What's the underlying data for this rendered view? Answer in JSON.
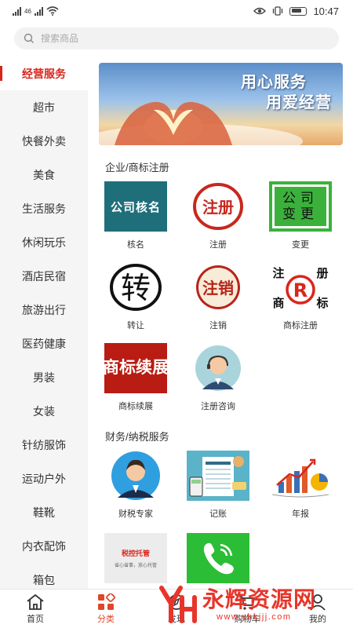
{
  "status_bar": {
    "signal_label": "46",
    "time": "10:47"
  },
  "search": {
    "placeholder": "搜索商品"
  },
  "sidebar": {
    "items": [
      {
        "label": "经营服务",
        "active": true
      },
      {
        "label": "超市"
      },
      {
        "label": "快餐外卖"
      },
      {
        "label": "美食"
      },
      {
        "label": "生活服务"
      },
      {
        "label": "休闲玩乐"
      },
      {
        "label": "酒店民宿"
      },
      {
        "label": "旅游出行"
      },
      {
        "label": "医药健康"
      },
      {
        "label": "男装"
      },
      {
        "label": "女装"
      },
      {
        "label": "针纺服饰"
      },
      {
        "label": "运动户外"
      },
      {
        "label": "鞋靴"
      },
      {
        "label": "内衣配饰"
      },
      {
        "label": "箱包"
      }
    ]
  },
  "banner": {
    "line1": "用心服务",
    "line2": "用爱经营"
  },
  "sections": [
    {
      "title": "企业/商标注册",
      "items": [
        {
          "label": "核名",
          "pic_text": "公司核名",
          "icon": "company-name-icon"
        },
        {
          "label": "注册",
          "pic_text": "注册",
          "icon": "register-stamp-icon"
        },
        {
          "label": "变更",
          "pic_text_1": "公司",
          "pic_text_2": "变更",
          "icon": "company-change-icon"
        },
        {
          "label": "转让",
          "pic_text": "转",
          "icon": "transfer-icon"
        },
        {
          "label": "注销",
          "pic_text": "注销",
          "icon": "cancel-stamp-icon"
        },
        {
          "label": "商标注册",
          "pic_text_1": "注",
          "pic_text_2": "册",
          "pic_text_3": "商",
          "pic_text_4": "标",
          "pic_text_r": "R",
          "icon": "trademark-icon"
        },
        {
          "label": "商标续展",
          "pic_text_1": "商",
          "pic_text_2": "标",
          "pic_text_3": "续",
          "pic_text_4": "展",
          "icon": "trademark-renewal-icon"
        },
        {
          "label": "注册咨询",
          "icon": "consultant-avatar-icon"
        }
      ]
    },
    {
      "title": "财务/纳税服务",
      "items": [
        {
          "label": "财税专家",
          "icon": "tax-expert-avatar-icon"
        },
        {
          "label": "记账",
          "icon": "bookkeeping-icon"
        },
        {
          "label": "年报",
          "icon": "annual-report-chart-icon"
        },
        {
          "label": "",
          "pic_text_1": "税控托管",
          "pic_text_2": "省心省事，放心托管",
          "icon": "tax-control-icon"
        },
        {
          "label": "",
          "icon": "phone-icon"
        }
      ]
    }
  ],
  "bottom_nav": {
    "items": [
      {
        "label": "首页",
        "icon": "home-icon"
      },
      {
        "label": "分类",
        "icon": "category-icon",
        "active": true
      },
      {
        "label": "发现",
        "icon": "discover-icon"
      },
      {
        "label": "购物车",
        "icon": "cart-icon"
      },
      {
        "label": "我的",
        "icon": "profile-icon"
      }
    ]
  },
  "watermark": {
    "title": "永辉资源网",
    "url": "www.yhkjjj.com"
  },
  "colors": {
    "accent": "#d9261c",
    "nav_active": "#e0462a"
  }
}
